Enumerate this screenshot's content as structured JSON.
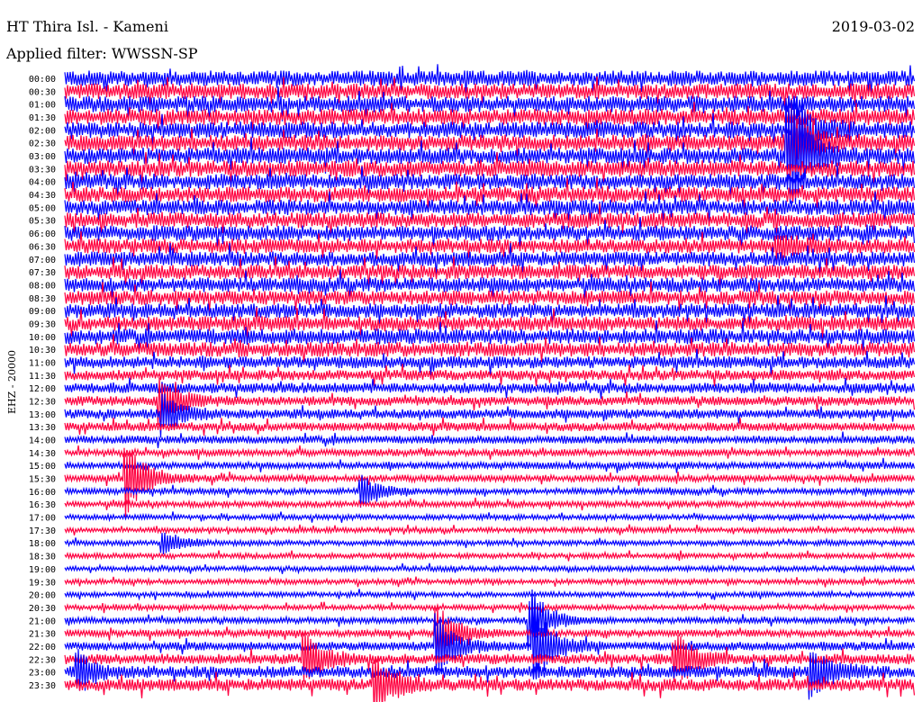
{
  "header": {
    "title": "HT Thira Isl. - Kameni",
    "date": "2019-03-02",
    "filter": "Applied filter: WWSSN-SP"
  },
  "chart_data": {
    "type": "line",
    "title": "HT Thira Isl. - Kameni",
    "ylabel": "EHZ - 20000",
    "xlabel": "",
    "minutes_per_row": 30,
    "row_labels": [
      "00:00",
      "00:30",
      "01:00",
      "01:30",
      "02:00",
      "02:30",
      "03:00",
      "03:30",
      "04:00",
      "04:30",
      "05:00",
      "05:30",
      "06:00",
      "06:30",
      "07:00",
      "07:30",
      "08:00",
      "08:30",
      "09:00",
      "09:30",
      "10:00",
      "10:30",
      "11:00",
      "11:30",
      "12:00",
      "12:30",
      "13:00",
      "13:30",
      "14:00",
      "14:30",
      "15:00",
      "15:30",
      "16:00",
      "16:30",
      "17:00",
      "17:30",
      "18:00",
      "18:30",
      "19:00",
      "19:30",
      "20:00",
      "20:30",
      "21:00",
      "21:30",
      "22:00",
      "22:30",
      "23:00",
      "23:30"
    ],
    "series_colors": [
      "#0000ff",
      "#ff0040"
    ],
    "noise_level": [
      0.9,
      0.9,
      0.95,
      0.95,
      0.95,
      0.95,
      0.95,
      0.95,
      0.9,
      0.9,
      0.9,
      0.9,
      0.9,
      0.85,
      0.85,
      0.85,
      0.85,
      0.85,
      0.85,
      0.85,
      0.9,
      0.85,
      0.7,
      0.6,
      0.6,
      0.55,
      0.55,
      0.5,
      0.45,
      0.4,
      0.4,
      0.4,
      0.35,
      0.35,
      0.3,
      0.3,
      0.3,
      0.3,
      0.3,
      0.3,
      0.3,
      0.3,
      0.35,
      0.4,
      0.5,
      0.6,
      0.7,
      0.7
    ],
    "events": [
      {
        "row": 6,
        "minute": 25.6,
        "amplitude": 6
      },
      {
        "row": 5,
        "minute": 25.6,
        "amplitude": 4
      },
      {
        "row": 4,
        "minute": 25.8,
        "amplitude": 3
      },
      {
        "row": 13,
        "minute": 25.2,
        "amplitude": 1.2
      },
      {
        "row": 25,
        "minute": 3.4,
        "amplitude": 2.5
      },
      {
        "row": 26,
        "minute": 3.5,
        "amplitude": 2
      },
      {
        "row": 31,
        "minute": 2.2,
        "amplitude": 4
      },
      {
        "row": 32,
        "minute": 10.5,
        "amplitude": 1.5
      },
      {
        "row": 36,
        "minute": 3.5,
        "amplitude": 1.2
      },
      {
        "row": 42,
        "minute": 16.5,
        "amplitude": 3
      },
      {
        "row": 43,
        "minute": 13.2,
        "amplitude": 3
      },
      {
        "row": 44,
        "minute": 16.6,
        "amplitude": 4
      },
      {
        "row": 44,
        "minute": 13.2,
        "amplitude": 3
      },
      {
        "row": 45,
        "minute": 8.5,
        "amplitude": 2.5
      },
      {
        "row": 45,
        "minute": 21.6,
        "amplitude": 2.5
      },
      {
        "row": 46,
        "minute": 26.4,
        "amplitude": 2.5
      },
      {
        "row": 46,
        "minute": 0.5,
        "amplitude": 2
      },
      {
        "row": 47,
        "minute": 11,
        "amplitude": 3
      }
    ]
  }
}
